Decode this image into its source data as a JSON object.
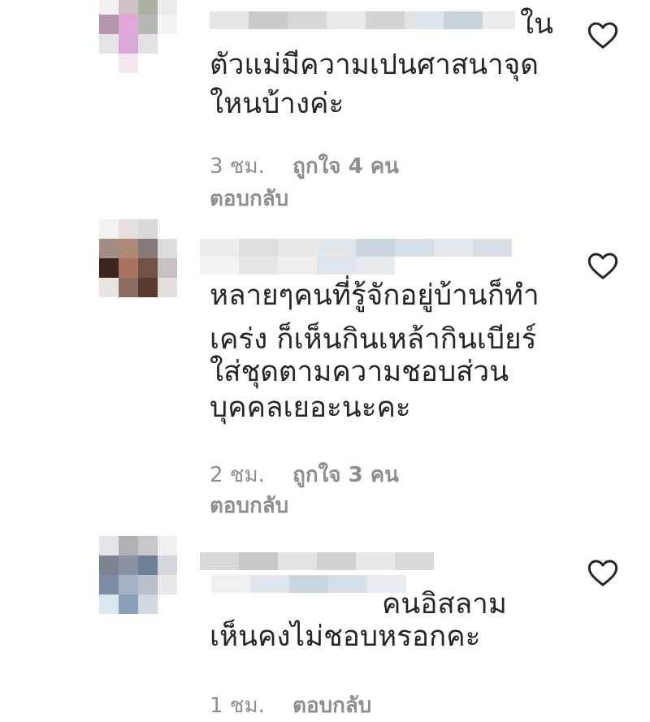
{
  "comments": [
    {
      "username_prefix_text": "ใน",
      "lines": [
        "ตัวแม่มีความเปนศาสนาจุด",
        "ใหนบ้างค่ะ"
      ],
      "time": "3 ชม.",
      "likes": "ถูกใจ 4 คน",
      "reply_label": "ตอบกลับ",
      "avatar_colors": [
        "#f4eef2",
        "#cfc0c6",
        "#a9b2a3",
        "#e9ecea",
        "#b596ad",
        "#e2a6db",
        "#b6b8b6",
        "#f3f3f3",
        "#e8e2e8",
        "#d8a9d6",
        "#e6dfe5",
        "#ffffff",
        "#ffffff",
        "#f4e7f2",
        "#ffffff",
        "#ffffff"
      ]
    },
    {
      "username_prefix_text": "",
      "lines": [
        "หลายๆคนที่รู้จักอยู่บ้านก็ทำ",
        "เคร่ง ก็เห็นกินเหล้ากินเบียร์",
        "ใส่ชุดตามความชอบส่วน",
        "บุคคลเยอะนะคะ"
      ],
      "time": "2 ชม.",
      "likes": "ถูกใจ 3 คน",
      "reply_label": "ตอบกลับ",
      "avatar_colors": [
        "#f4f2f1",
        "#e5dedb",
        "#dcd8d6",
        "#ffffff",
        "#a08e86",
        "#b08a78",
        "#857a78",
        "#dedbda",
        "#3d2420",
        "#a97360",
        "#6f5145",
        "#c7c1bf",
        "#ebe4e0",
        "#8a6c60",
        "#5a3a2f",
        "#e2dcda"
      ]
    },
    {
      "username_prefix_text": "คนอิสลาม",
      "lines": [
        "เห็นคงไม่ชอบหรอกคะ"
      ],
      "time": "1 ชม.",
      "likes": "",
      "reply_label": "ตอบกลับ",
      "avatar_colors": [
        "#e3e5ea",
        "#aeb1b8",
        "#c6c7cb",
        "#f0f0f2",
        "#7d8390",
        "#8b93a3",
        "#6e8198",
        "#d3d6dc",
        "#7f8ea6",
        "#a7b2c6",
        "#b8bfcc",
        "#e6e8ec",
        "#d9e7ef",
        "#8aa0b8",
        "#d2d8e0",
        "#ffffff"
      ]
    }
  ],
  "blur_colors": {
    "light": [
      "#eeeeee",
      "#e0e0e0",
      "#d2d2d2",
      "#c7c7c7",
      "#dcdcdc",
      "#e8e8e8"
    ],
    "blue": [
      "#d9e2ec",
      "#ccd6e2",
      "#bfcad8",
      "#e2e8ee"
    ]
  }
}
